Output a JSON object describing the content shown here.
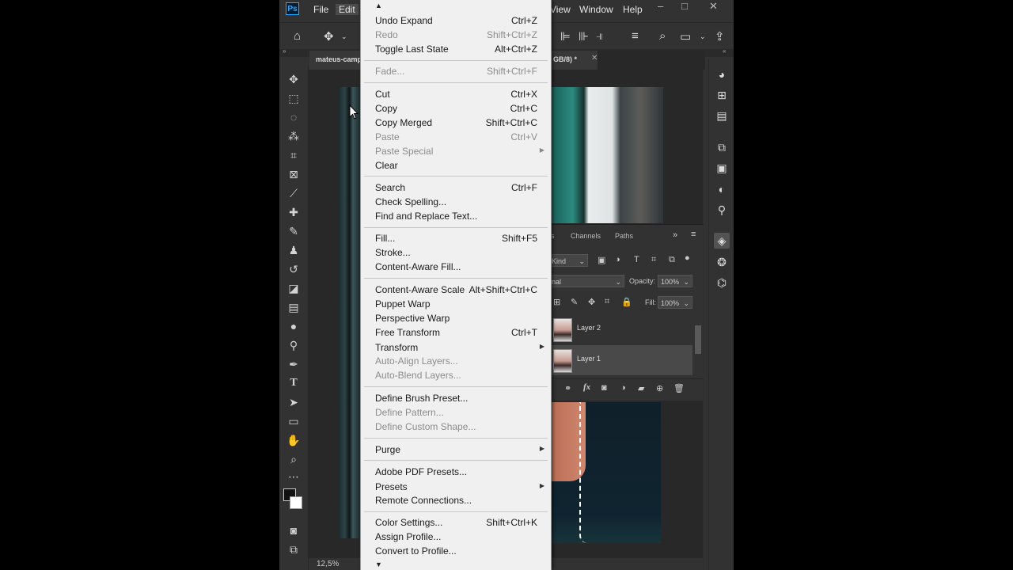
{
  "app": {
    "logo": "Ps",
    "menubar": [
      "File",
      "Edit",
      "View",
      "Window",
      "Help"
    ],
    "document_tab": "mateus-camp",
    "document_tab_suffix": "GB/8) *",
    "zoom": "12,5%"
  },
  "edit_menu": {
    "items": [
      {
        "label": "Undo Expand",
        "shortcut": "Ctrl+Z",
        "enabled": true
      },
      {
        "label": "Redo",
        "shortcut": "Shift+Ctrl+Z",
        "enabled": false
      },
      {
        "label": "Toggle Last State",
        "shortcut": "Alt+Ctrl+Z",
        "enabled": true
      },
      {
        "label": "Fade...",
        "shortcut": "Shift+Ctrl+F",
        "enabled": false
      },
      {
        "label": "Cut",
        "shortcut": "Ctrl+X",
        "enabled": true
      },
      {
        "label": "Copy",
        "shortcut": "Ctrl+C",
        "enabled": true
      },
      {
        "label": "Copy Merged",
        "shortcut": "Shift+Ctrl+C",
        "enabled": true
      },
      {
        "label": "Paste",
        "shortcut": "Ctrl+V",
        "enabled": false
      },
      {
        "label": "Paste Special",
        "shortcut": "",
        "enabled": false,
        "submenu": true
      },
      {
        "label": "Clear",
        "shortcut": "",
        "enabled": true
      },
      {
        "label": "Search",
        "shortcut": "Ctrl+F",
        "enabled": true
      },
      {
        "label": "Check Spelling...",
        "shortcut": "",
        "enabled": true
      },
      {
        "label": "Find and Replace Text...",
        "shortcut": "",
        "enabled": true
      },
      {
        "label": "Fill...",
        "shortcut": "Shift+F5",
        "enabled": true
      },
      {
        "label": "Stroke...",
        "shortcut": "",
        "enabled": true
      },
      {
        "label": "Content-Aware Fill...",
        "shortcut": "",
        "enabled": true
      },
      {
        "label": "Content-Aware Scale",
        "shortcut": "Alt+Shift+Ctrl+C",
        "enabled": true
      },
      {
        "label": "Puppet Warp",
        "shortcut": "",
        "enabled": true
      },
      {
        "label": "Perspective Warp",
        "shortcut": "",
        "enabled": true
      },
      {
        "label": "Free Transform",
        "shortcut": "Ctrl+T",
        "enabled": true
      },
      {
        "label": "Transform",
        "shortcut": "",
        "enabled": true,
        "submenu": true
      },
      {
        "label": "Auto-Align Layers...",
        "shortcut": "",
        "enabled": false
      },
      {
        "label": "Auto-Blend Layers...",
        "shortcut": "",
        "enabled": false
      },
      {
        "label": "Define Brush Preset...",
        "shortcut": "",
        "enabled": true
      },
      {
        "label": "Define Pattern...",
        "shortcut": "",
        "enabled": false
      },
      {
        "label": "Define Custom Shape...",
        "shortcut": "",
        "enabled": false
      },
      {
        "label": "Purge",
        "shortcut": "",
        "enabled": true,
        "submenu": true
      },
      {
        "label": "Adobe PDF Presets...",
        "shortcut": "",
        "enabled": true
      },
      {
        "label": "Presets",
        "shortcut": "",
        "enabled": true,
        "submenu": true
      },
      {
        "label": "Remote Connections...",
        "shortcut": "",
        "enabled": true
      },
      {
        "label": "Color Settings...",
        "shortcut": "Shift+Ctrl+K",
        "enabled": true
      },
      {
        "label": "Assign Profile...",
        "shortcut": "",
        "enabled": true
      },
      {
        "label": "Convert to Profile...",
        "shortcut": "",
        "enabled": true
      }
    ]
  },
  "layers_panel": {
    "tabs": [
      "rs",
      "Channels",
      "Paths"
    ],
    "kind_filter": "Kind",
    "blend_mode": "nal",
    "opacity_label": "Opacity:",
    "opacity_value": "100%",
    "fill_label": "Fill:",
    "fill_value": "100%",
    "layers": [
      "Layer 2",
      "Layer 1"
    ],
    "selected_layer": "Layer 1"
  }
}
